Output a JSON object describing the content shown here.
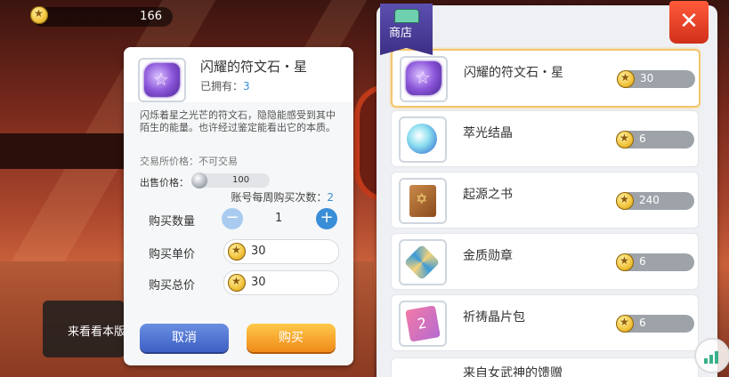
{
  "currency": {
    "amount": "166"
  },
  "detail": {
    "name": "闪耀的符文石・星",
    "owned_label": "已拥有：",
    "owned_count": "3",
    "description": "闪烁着星之光芒的符文石，隐隐能感受到其中陌生的能量。也许经过鉴定能看出它的本质。",
    "trade_price": "交易所价格：不可交易",
    "sell_label": "出售价格：",
    "sell_value": "100",
    "weekly_label": "账号每周购买次数：",
    "weekly_count": "2",
    "qty_label": "购买数量",
    "qty_value": "1",
    "unit_label": "购买单价",
    "unit_value": "30",
    "total_label": "购买总价",
    "total_value": "30",
    "cancel": "取消",
    "buy": "购买"
  },
  "hint": {
    "text": "来看看本版"
  },
  "shop": {
    "title": "商店",
    "close": "✕",
    "items": [
      {
        "name": "闪耀的符文石・星",
        "price": "30"
      },
      {
        "name": "萃光结晶",
        "price": "6"
      },
      {
        "name": "起源之书",
        "price": "240"
      },
      {
        "name": "金质勋章",
        "price": "6"
      },
      {
        "name": "祈祷晶片包",
        "price": "6"
      },
      {
        "name": "来自女武神的馈赠"
      }
    ]
  },
  "colors": {
    "accent_blue": "#3a8ed8",
    "buy_orange": "#f08a1a",
    "cancel_blue": "#3d5fc4",
    "close_red": "#d0301a",
    "shop_tag": "#3c2f85"
  }
}
